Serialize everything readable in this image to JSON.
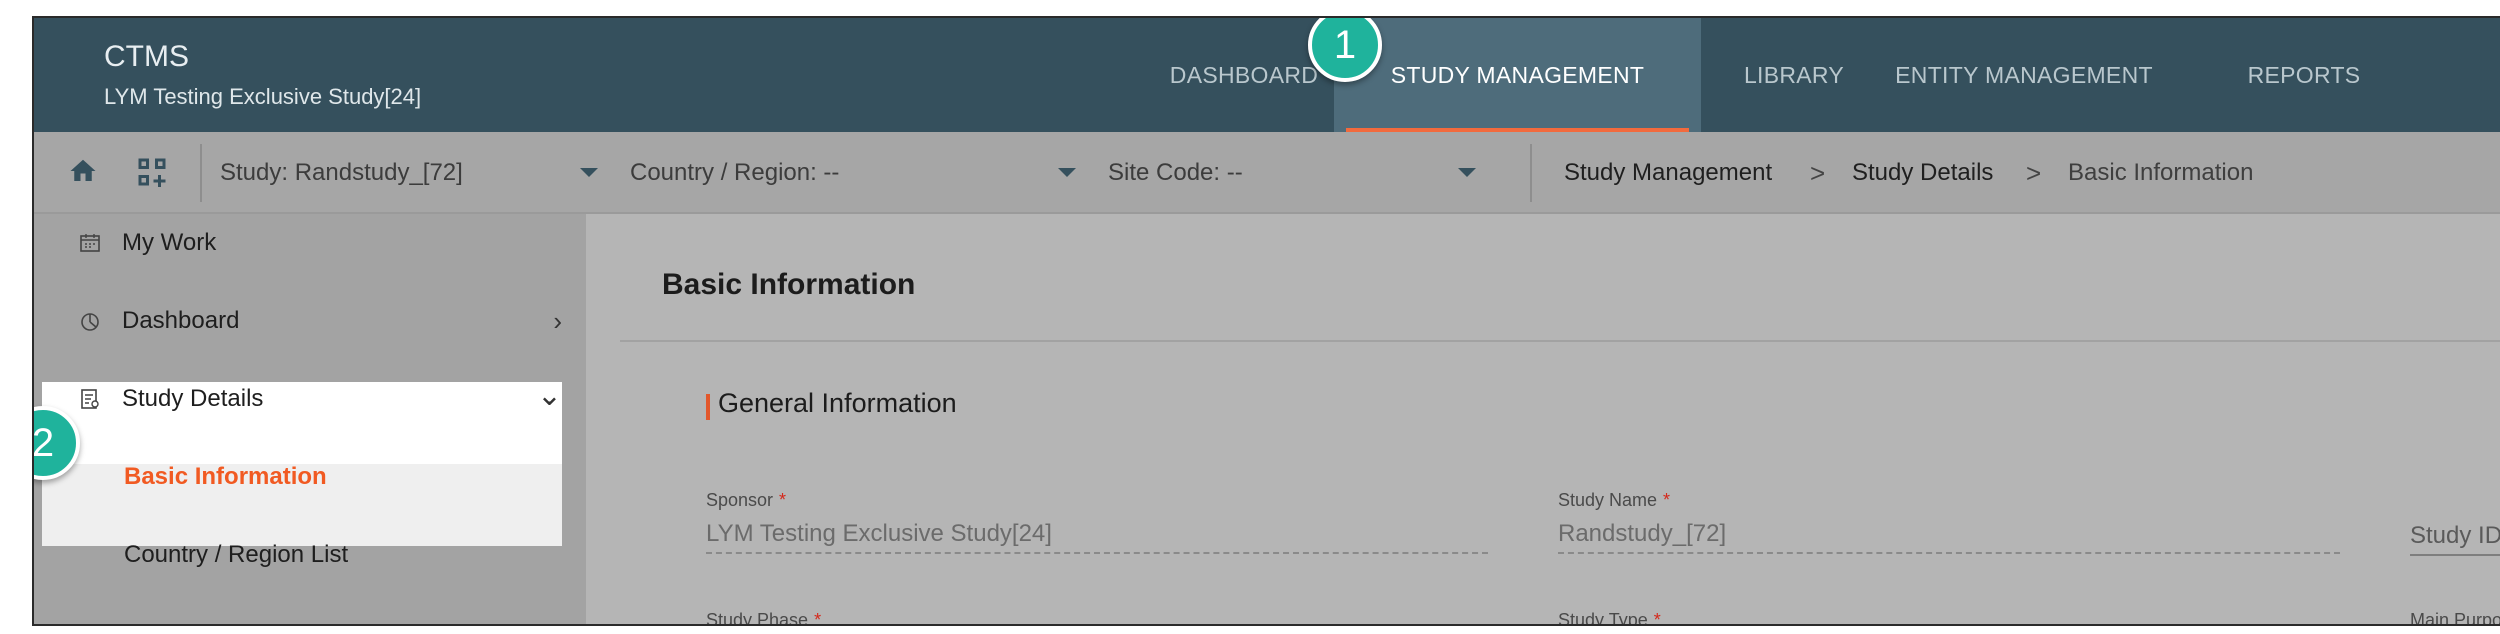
{
  "header": {
    "app_name": "CTMS",
    "study_name": "LYM Testing Exclusive Study[24]",
    "nav": [
      {
        "label": "DASHBOARD"
      },
      {
        "label": "STUDY MANAGEMENT"
      },
      {
        "label": "LIBRARY"
      },
      {
        "label": "ENTITY MANAGEMENT"
      },
      {
        "label": "REPORTS"
      }
    ],
    "active_nav": "STUDY MANAGEMENT"
  },
  "subbar": {
    "home_icon": "home-icon",
    "apps_icon": "dashboard-add-icon",
    "study_selector": "Study: Randstudy_[72]",
    "country_selector": "Country / Region: --",
    "site_selector": "Site Code: --",
    "breadcrumb": [
      "Study Management",
      "Study Details",
      "Basic Information"
    ],
    "breadcrumb_separator": ">"
  },
  "sidebar": {
    "items": [
      {
        "label": "My Work",
        "icon": "calendar-icon"
      },
      {
        "label": "Dashboard",
        "icon": "pie-chart-icon",
        "arrow": "›"
      },
      {
        "label": "Study Details",
        "icon": "document-icon",
        "arrow": "⌄"
      },
      {
        "label": "Basic Information"
      },
      {
        "label": "Country / Region List"
      }
    ]
  },
  "main": {
    "panel_title": "Basic Information",
    "section_title": "General Information",
    "fields": {
      "sponsor_label": "Sponsor",
      "sponsor_value": "LYM Testing Exclusive Study[24]",
      "study_name_label": "Study Name",
      "study_name_value": "Randstudy_[72]",
      "study_id_label": "Study ID",
      "study_phase_label": "Study Phase",
      "study_type_label": "Study Type",
      "main_purpose_label": "Main Purpose"
    },
    "required_marker": "*"
  },
  "annotations": {
    "badge_1": "1",
    "badge_2": "2"
  },
  "colors": {
    "header_bg": "#35505d",
    "active_tab_bg": "#4e6c7b",
    "accent": "#f26a3d",
    "badge": "#1fb39c"
  }
}
